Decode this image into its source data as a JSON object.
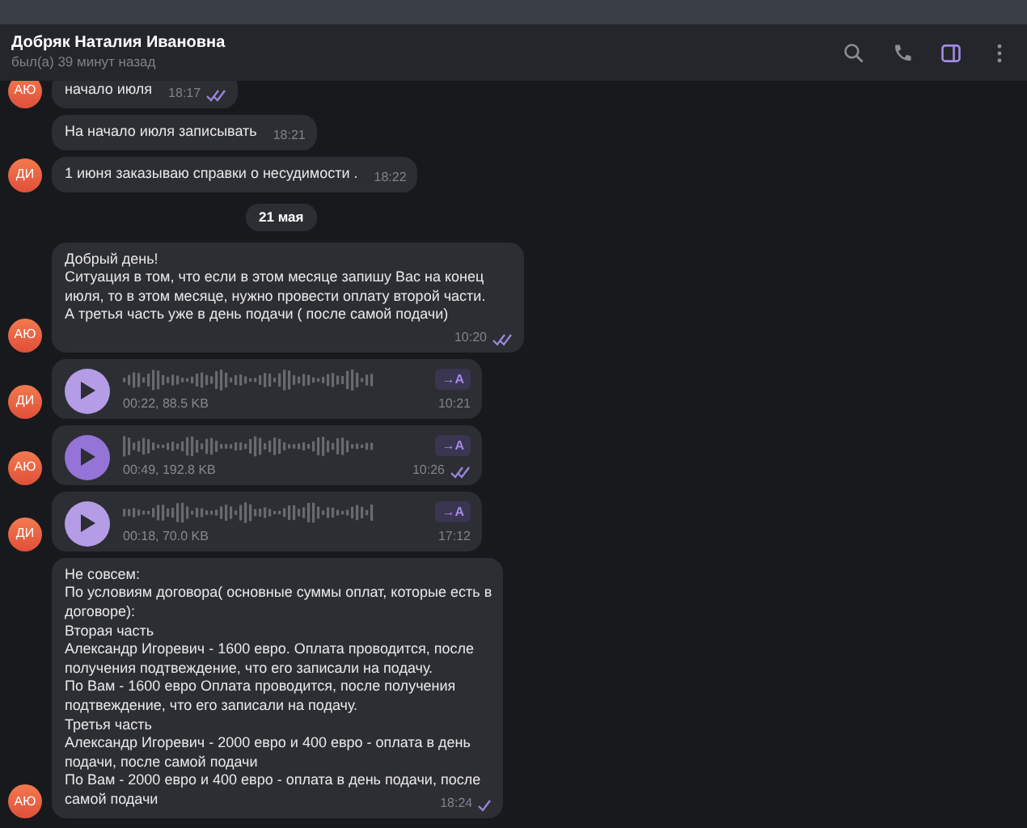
{
  "header": {
    "title": "Добряк Наталия Ивановна",
    "status": "был(а) 39 минут назад",
    "info_panel_on": true
  },
  "messages": [
    {
      "kind": "text",
      "avatar": "АЮ",
      "lines": [
        "начало июля"
      ],
      "time": "18:17",
      "outgoing": true,
      "read": true
    },
    {
      "kind": "text",
      "lines": [
        "На начало июля записывать"
      ],
      "time": "18:21"
    },
    {
      "kind": "text",
      "avatar": "ДИ",
      "lines": [
        "1 июня заказываю справки о  несудимости ."
      ],
      "time": "18:22"
    },
    {
      "kind": "date",
      "text": "21 мая"
    },
    {
      "kind": "text",
      "avatar": "АЮ",
      "lines": [
        "Добрый день!",
        "Ситуация в том, что если в этом месяце запишу Вас на конец",
        "июля, то в этом месяце, нужно провести оплату второй части.",
        "А третья часть уже в день подачи ( после самой подачи)"
      ],
      "time": "10:20",
      "outgoing": true,
      "read": true
    },
    {
      "kind": "voice",
      "avatar": "ДИ",
      "info": "00:22, 88.5 KB",
      "transcribe": "→A",
      "time": "10:21"
    },
    {
      "kind": "voice",
      "avatar": "АЮ",
      "info": "00:49, 192.8 KB",
      "transcribe": "→A",
      "time": "10:26",
      "outgoing": true,
      "read": true
    },
    {
      "kind": "voice",
      "avatar": "ДИ",
      "info": "00:18, 70.0 KB",
      "transcribe": "→A",
      "time": "17:12"
    },
    {
      "kind": "text",
      "avatar": "АЮ",
      "lines": [
        "Не совсем:",
        "По условиям договора( основные суммы оплат, которые есть в",
        "договоре):",
        "Вторая часть",
        "Александр Игоревич - 1600 евро. Оплата проводится, после",
        "получения подтвеждение, что его записали на подачу.",
        "По Вам - 1600 евро  Оплата проводится, после получения",
        "подтвеждение, что его записали на подачу.",
        "Третья часть",
        "Александр Игоревич - 2000 евро и 400 евро - оплата в день",
        "подачи, после самой подачи",
        "По Вам - 2000 евро и 400 евро - оплата в день подачи, после",
        "самой подачи"
      ],
      "time": "18:24",
      "outgoing": true,
      "read": false
    }
  ]
}
